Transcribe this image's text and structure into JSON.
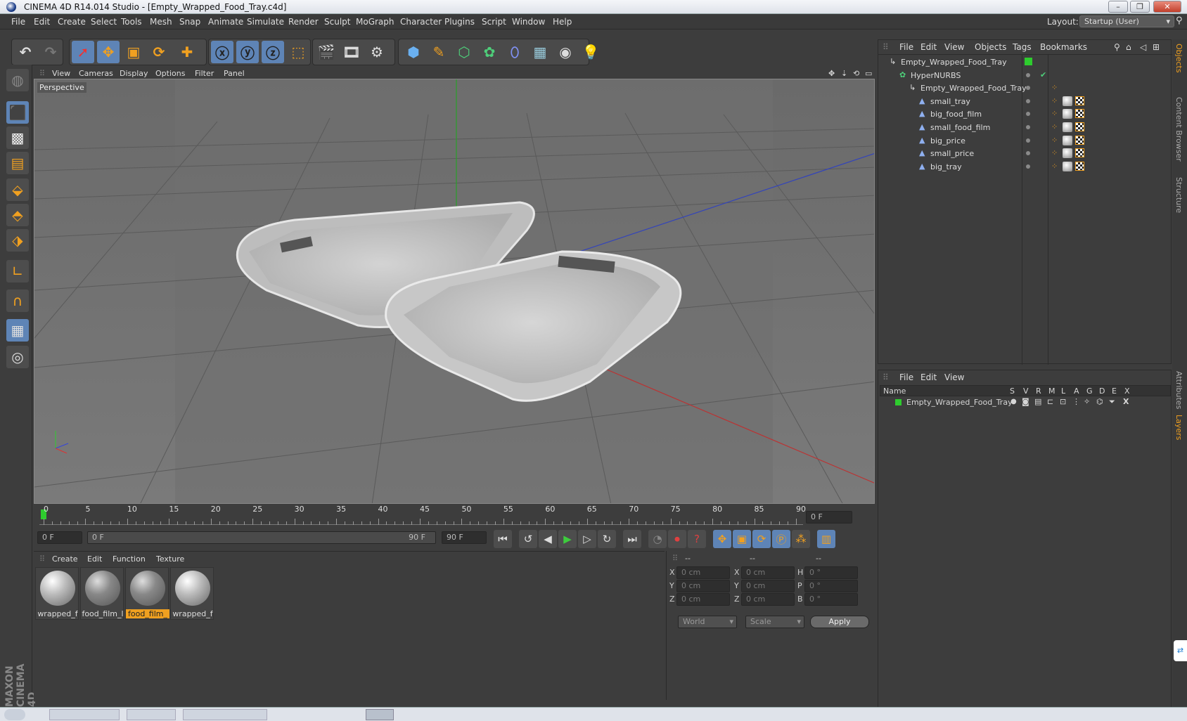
{
  "window": {
    "title": "CINEMA 4D R14.014 Studio - [Empty_Wrapped_Food_Tray.c4d]"
  },
  "menu": [
    "File",
    "Edit",
    "Create",
    "Select",
    "Tools",
    "Mesh",
    "Snap",
    "Animate",
    "Simulate",
    "Render",
    "Sculpt",
    "MoGraph",
    "Character",
    "Plugins",
    "Script",
    "Window",
    "Help"
  ],
  "layout": {
    "label": "Layout:",
    "value": "Startup (User)"
  },
  "viewport": {
    "menu": [
      "View",
      "Cameras",
      "Display",
      "Options",
      "Filter",
      "Panel"
    ],
    "camera": "Perspective"
  },
  "timeline": {
    "ticks": [
      "0",
      "5",
      "10",
      "15",
      "20",
      "25",
      "30",
      "35",
      "40",
      "45",
      "50",
      "55",
      "60",
      "65",
      "70",
      "75",
      "80",
      "85",
      "90"
    ],
    "current_frame": "0 F"
  },
  "transport": {
    "start": "0 F",
    "range_start": "0 F",
    "range_end": "90 F",
    "end": "90 F"
  },
  "materials": {
    "menu": [
      "Create",
      "Edit",
      "Function",
      "Texture"
    ],
    "items": [
      "wrapped_f",
      "food_film_l",
      "food_film_",
      "wrapped_f"
    ]
  },
  "coords": {
    "headers": [
      "--",
      "--",
      "--"
    ],
    "rows": [
      {
        "a": "X",
        "av": "0 cm",
        "b": "X",
        "bv": "0 cm",
        "c": "H",
        "cv": "0 °"
      },
      {
        "a": "Y",
        "av": "0 cm",
        "b": "Y",
        "bv": "0 cm",
        "c": "P",
        "cv": "0 °"
      },
      {
        "a": "Z",
        "av": "0 cm",
        "b": "Z",
        "bv": "0 cm",
        "c": "B",
        "cv": "0 °"
      }
    ],
    "mode1": "World",
    "mode2": "Scale",
    "apply": "Apply"
  },
  "objects": {
    "menu": [
      "File",
      "Edit",
      "View",
      "Objects",
      "Tags",
      "Bookmarks"
    ],
    "tree": [
      {
        "name": "Empty_Wrapped_Food_Tray",
        "indent": 0
      },
      {
        "name": "HyperNURBS",
        "indent": 1
      },
      {
        "name": "Empty_Wrapped_Food_Tray",
        "indent": 2
      },
      {
        "name": "small_tray",
        "indent": 3
      },
      {
        "name": "big_food_film",
        "indent": 3
      },
      {
        "name": "small_food_film",
        "indent": 3
      },
      {
        "name": "big_price",
        "indent": 3
      },
      {
        "name": "small_price",
        "indent": 3
      },
      {
        "name": "big_tray",
        "indent": 3
      }
    ]
  },
  "layers": {
    "menu": [
      "File",
      "Edit",
      "View"
    ],
    "cols": [
      "Name",
      "S",
      "V",
      "R",
      "M",
      "L",
      "A",
      "G",
      "D",
      "E",
      "X"
    ],
    "row": "Empty_Wrapped_Food_Tray"
  },
  "side_tabs": [
    "Objects",
    "Content Browser",
    "Structure",
    "Attributes",
    "Layers"
  ],
  "brand": "MAXON CINEMA 4D",
  "colors": {
    "accent": "#f0a020",
    "select": "#5e84b6",
    "layer_green": "#2ecc2e"
  }
}
